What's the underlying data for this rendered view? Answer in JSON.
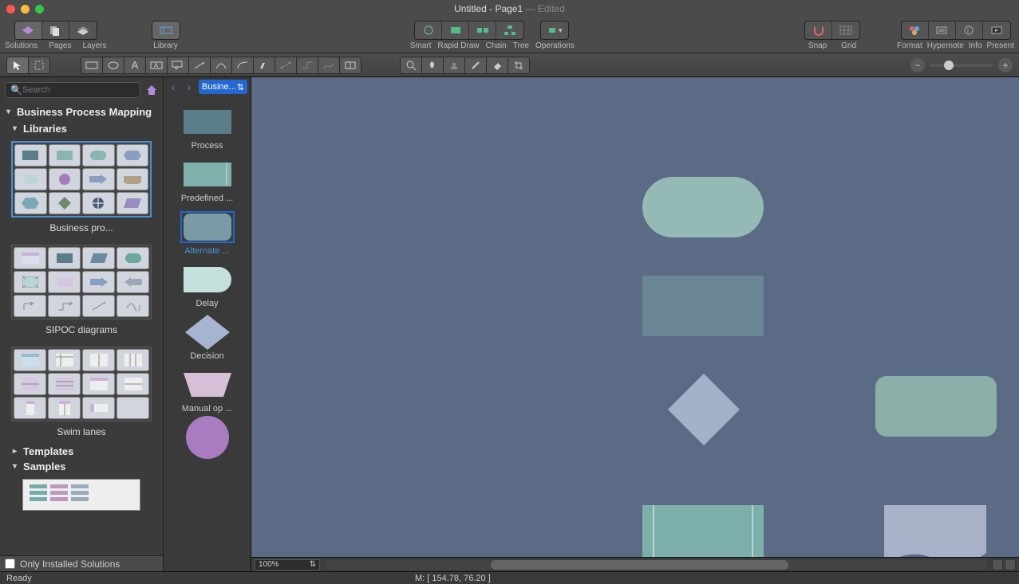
{
  "window": {
    "title": "Untitled - Page1",
    "edited": " — Edited"
  },
  "toolbar": {
    "solutions": "Solutions",
    "pages": "Pages",
    "layers": "Layers",
    "library": "Library",
    "smart": "Smart",
    "rapiddraw": "Rapid Draw",
    "chain": "Chain",
    "tree": "Tree",
    "operations": "Operations",
    "snap": "Snap",
    "grid": "Grid",
    "format": "Format",
    "hypernote": "Hypernote",
    "info": "Info",
    "present": "Present"
  },
  "sidebar": {
    "search_placeholder": "Search",
    "heading": "Business Process Mapping",
    "libraries": "Libraries",
    "templates": "Templates",
    "samples": "Samples",
    "lib1": "Business pro...",
    "lib2": "SIPOC diagrams",
    "lib3": "Swim lanes",
    "only_installed": "Only Installed Solutions"
  },
  "shapes": {
    "selector": "Busine...",
    "items": [
      {
        "label": "Process"
      },
      {
        "label": "Predefined ..."
      },
      {
        "label": "Alternate ..."
      },
      {
        "label": "Delay"
      },
      {
        "label": "Decision"
      },
      {
        "label": "Manual op ..."
      }
    ]
  },
  "zoom": {
    "value": "100%"
  },
  "status": {
    "ready": "Ready",
    "coords": "M: [ 154.78, 76.20 ]"
  }
}
